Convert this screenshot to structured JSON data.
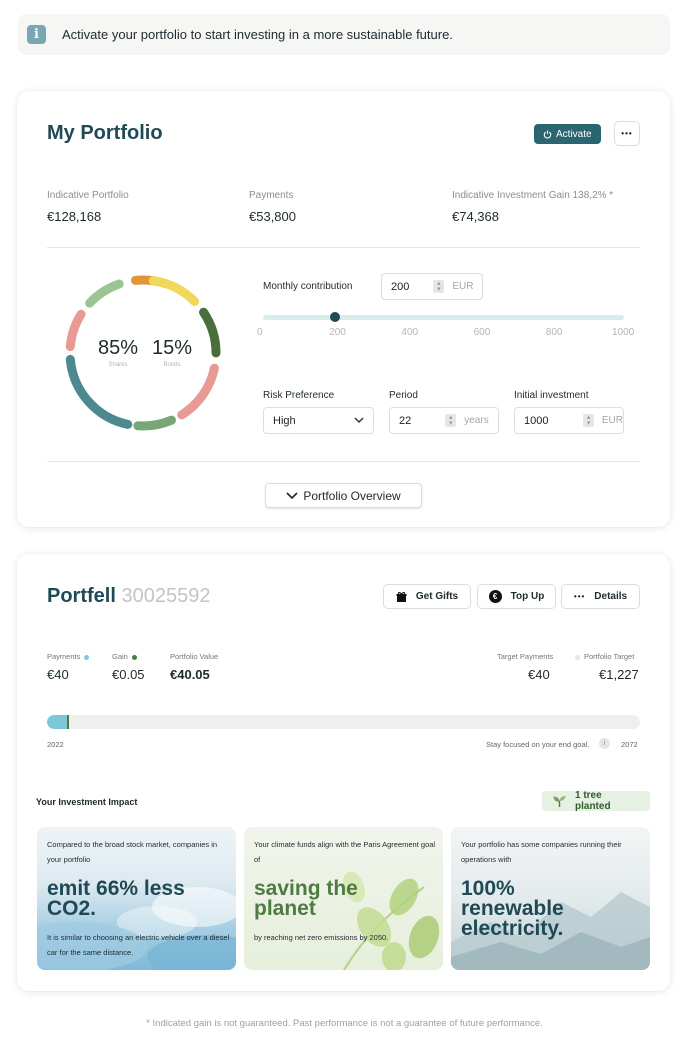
{
  "banner": {
    "icon": "info-icon",
    "text": "Activate your portfolio to start investing in a more sustainable future."
  },
  "portfolio": {
    "title": "My Portfolio",
    "activate_label": "Activate",
    "more_label": "•••",
    "stats": [
      {
        "label": "Indicative Portfolio",
        "value": "€128,168"
      },
      {
        "label": "Payments",
        "value": "€53,800"
      },
      {
        "label": "Indicative Investment Gain 138,2% *",
        "value": "€74,368"
      }
    ],
    "donut": {
      "shares_pct": "85%",
      "shares_label": "Shares",
      "bonds_pct": "15%",
      "bonds_label": "Bonds",
      "colors": [
        "#4d8a90",
        "#e89a94",
        "#9cc593",
        "#e2963a",
        "#f0d85a",
        "#4a6e3b",
        "#e89a94",
        "#77a679"
      ]
    },
    "monthly": {
      "label": "Monthly contribution",
      "value": "200",
      "unit": "EUR"
    },
    "slider": {
      "value": 200,
      "min": 0,
      "max": 1000,
      "ticks": [
        "0",
        "200",
        "400",
        "600",
        "800",
        "1000"
      ]
    },
    "risk": {
      "label": "Risk Preference",
      "value": "High"
    },
    "period": {
      "label": "Period",
      "value": "22",
      "unit": "years"
    },
    "initial": {
      "label": "Initial investment",
      "value": "1000",
      "unit": "EUR"
    },
    "overview_label": "Portfolio Overview"
  },
  "portfell": {
    "title": "Portfell",
    "number": "30025592",
    "get_gifts": "Get Gifts",
    "top_up": "Top Up",
    "details": "Details",
    "payments_label": "Payments",
    "payments_value": "€40",
    "gain_label": "Gain",
    "gain_value": "€0.05",
    "portfolio_value_label": "Portfolio Value",
    "portfolio_value": "€40.05",
    "target_payments_label": "Target Payments",
    "target_payments_value": "€40",
    "portfolio_target_label": "Portfolio Target",
    "portfolio_target_value": "€1,227",
    "progress": 0.035,
    "start_year": "2022",
    "end_year": "2072",
    "focus_text": "Stay focused on your end goal.",
    "colors": {
      "payments": "#7ec7d9",
      "gain": "#4f7a43",
      "target": "#e6e6e6"
    }
  },
  "impact": {
    "title": "Your Investment Impact",
    "tree_badge": "1  tree planted",
    "cards": [
      {
        "intro": "Compared to the broad stock market, companies in your portfolio",
        "headline": "emit 66% less CO2.",
        "detail": "It is similar to choosing an electric vehicle over a diesel car for the same distance."
      },
      {
        "intro": "Your climate funds align with the Paris Agreement goal of",
        "headline": "saving the planet",
        "detail": "by reaching net zero emissions by 2050."
      },
      {
        "intro": "Your portfolio has some companies running their operations with",
        "headline": "100% renewable electricity.",
        "detail": ""
      }
    ]
  },
  "footer": "* Indicated gain is not guaranteed. Past performance is not a guarantee of future performance."
}
